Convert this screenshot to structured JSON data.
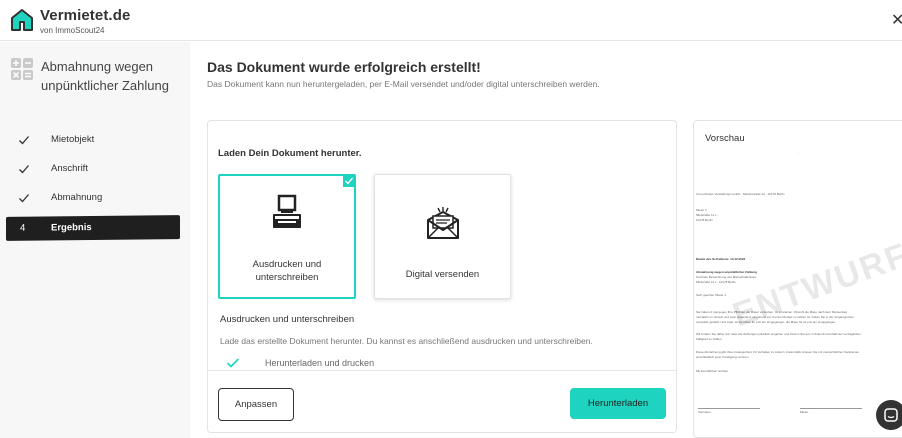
{
  "header": {
    "brand_name": "Vermietet.de",
    "brand_sub": "von ImmoScout24",
    "close_icon": "close-icon"
  },
  "sidebar": {
    "title": "Abmahnung wegen unpünktlicher Zahlung",
    "icon": "calculator-icon",
    "steps": [
      {
        "label": "Mietobjekt",
        "state": "done"
      },
      {
        "label": "Anschrift",
        "state": "done"
      },
      {
        "label": "Abmahnung",
        "state": "done"
      },
      {
        "number": "4",
        "label": "Ergebnis",
        "state": "active"
      }
    ]
  },
  "main": {
    "title": "Das Dokument wurde erfolgreich erstellt!",
    "subtitle": "Das Dokument kann nun heruntergeladen, per E-Mail versendet und/oder digital unterschreiben werden.",
    "card": {
      "heading": "Laden Dein Dokument herunter.",
      "options": [
        {
          "label": "Ausdrucken und unterschreiben",
          "icon": "printer-icon",
          "selected": true
        },
        {
          "label": "Digital versenden",
          "icon": "envelope-icon",
          "selected": false
        }
      ],
      "section_title": "Ausdrucken und unterschreiben",
      "section_desc": "Lade das erstellte Dokument herunter. Du kannst es anschließend ausdrucken und unterschreiben.",
      "bullets": [
        "Herunterladen und drucken"
      ],
      "buttons": {
        "secondary": "Anpassen",
        "primary": "Herunterladen"
      }
    }
  },
  "preview": {
    "title": "Vorschau",
    "watermark": "ENTWURF",
    "lines": {
      "sender": "Immo-Muster Verwaltungs GmbH · Musterstraße 12 · 10178 Berlin",
      "addr1": "Mieter 1",
      "addr2": "Mietstraße 11 c ,",
      "addr3": "10178 Berlin",
      "date": "Datum des Schreibens: 10.12.2022",
      "subject1": "Abmahnung wegen unpünktlicher Zahlung",
      "subject2": "Konkrete Bezeichnung des Mietverhältnisses:",
      "subject3": "Mietstraße 11 c , 10178 Berlin",
      "greeting": "Sehr geehrter Mieter 1,",
      "p1a": "Sie haben 2 mal gegen Ihre Pflichten als Mieter verstoßen. Im Einzelnen: Obwohl die Miete nach dem Mietvertrag",
      "p1b": "monatlich im Voraus und zwar spätestens eingehend am 3 eines Monats zu zahlen ist, haben Sie in der Vergangenheit",
      "p1c": "verspätet gezahlt. Und zwar: ist die Miete für   erst am   eingegangen, die Miete für   ist erst am   eingegangen.",
      "p2a": "Wir fordern Sie daher auf, dass die Zahlungen pünktlich eingehen und fordern Sie auf, in Zukunft innerhalb der vertraglichen",
      "p2b": "Fälligkeit zu zahlen.",
      "p3a": "Diese Abmahnung gibt Ihnen Gelegenheit, Ihr Verhalten zu ändern. Andernfalls müssen Sie mit mietrechtlichen Sanktionen",
      "p3b": "einschließlich einer Kündigung rechnen.",
      "closing": "Mit freundlichen Grüßen",
      "sig1": "Vermieter",
      "sig2": "Mieter"
    }
  },
  "chat_icon": "chat-icon",
  "colors": {
    "accent": "#1ed3c0",
    "dark": "#1f1f1f",
    "sidebar_bg": "#f7f7f7"
  }
}
